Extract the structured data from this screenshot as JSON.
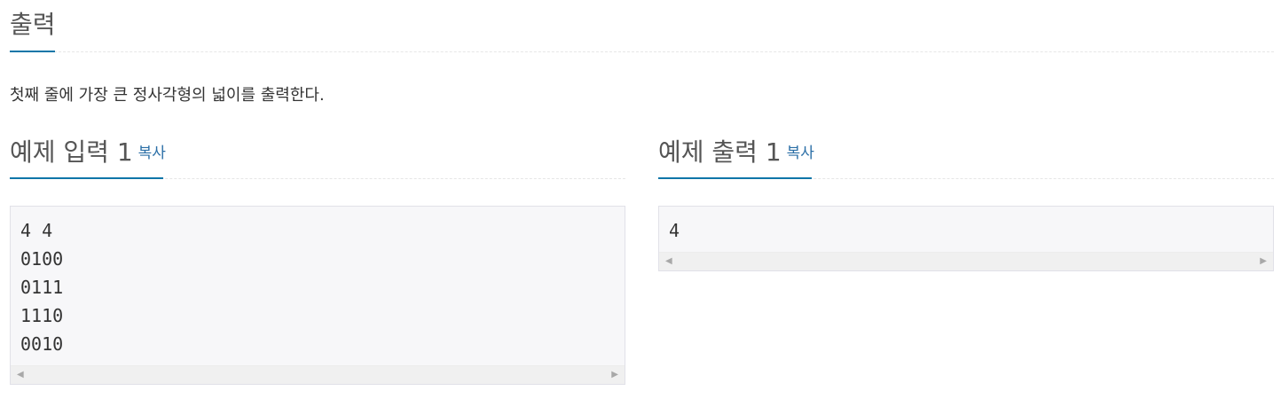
{
  "section": {
    "title": "출력",
    "description": "첫째 줄에 가장 큰 정사각형의 넓이를 출력한다."
  },
  "samples": [
    {
      "title": "예제 입력 1",
      "copy_label": "복사",
      "content": "4 4\n0100\n0111\n1110\n0010"
    },
    {
      "title": "예제 출력 1",
      "copy_label": "복사",
      "content": "4"
    }
  ],
  "colors": {
    "accent": "#0e76a8",
    "link": "#2a6ea6",
    "code_background": "#f7f7f9"
  },
  "icons": {
    "scroll_left": "scroll-left-arrow-icon",
    "scroll_right": "scroll-right-arrow-icon"
  }
}
